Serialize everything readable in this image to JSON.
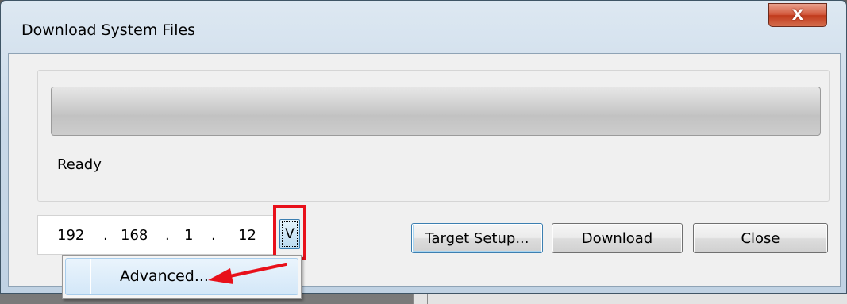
{
  "window": {
    "title": "Download System Files",
    "close_glyph": "X"
  },
  "progress": {
    "value": 0
  },
  "status": {
    "text": "Ready"
  },
  "ip_address": {
    "octet1": "192",
    "dot1": ".",
    "octet2": "168",
    "dot2": ".",
    "octet3": "1",
    "dot3": ".",
    "octet4": "12"
  },
  "dropdown_button": {
    "label": "V"
  },
  "buttons": {
    "target_setup": "Target Setup...",
    "download": "Download",
    "close": "Close"
  },
  "context_menu": {
    "items": [
      {
        "label": "Advanced..."
      }
    ]
  },
  "annotation": {
    "highlight_color": "#e8101a",
    "arrow_color": "#e8101a"
  },
  "icons": {
    "close": "close-icon",
    "arrow": "arrow-icon"
  }
}
